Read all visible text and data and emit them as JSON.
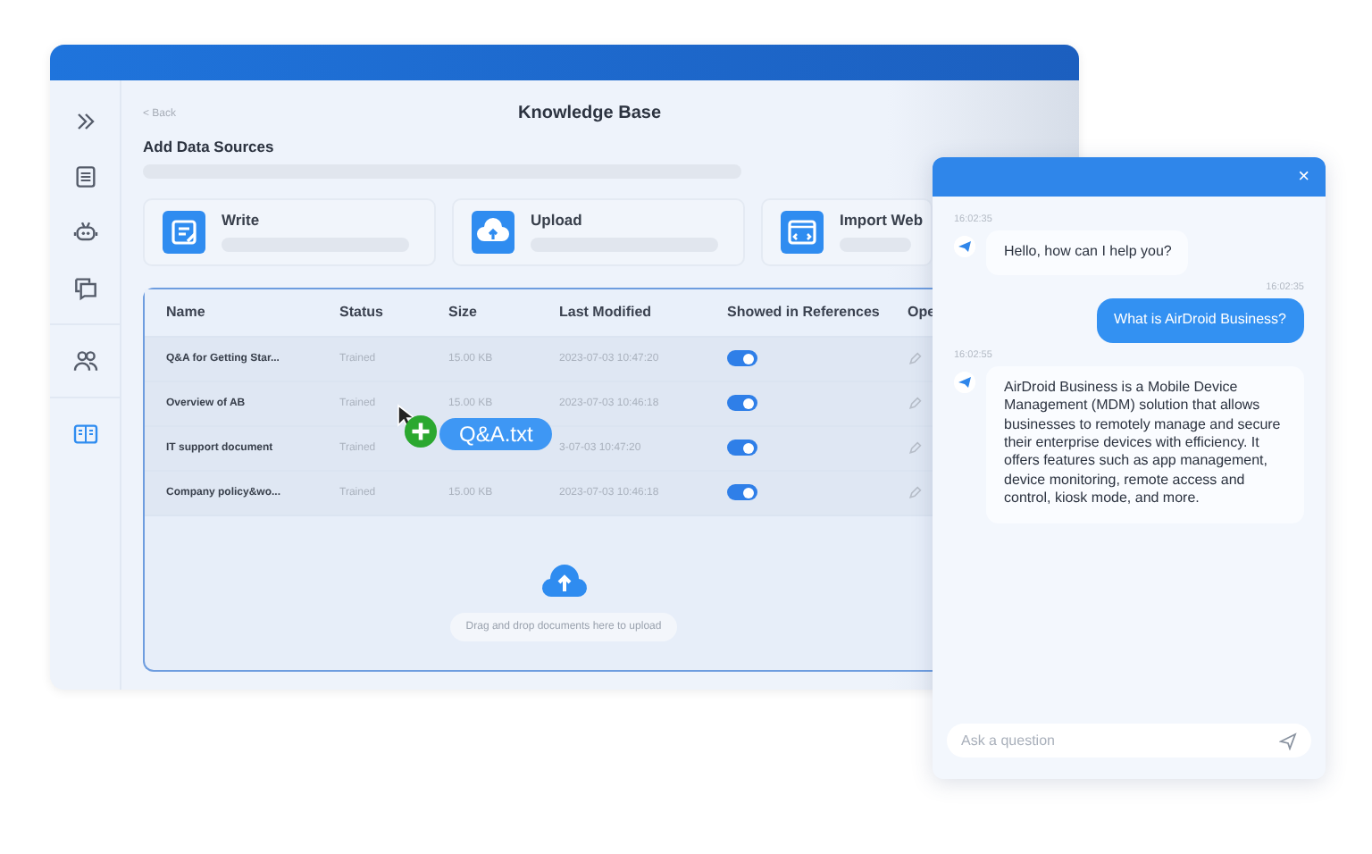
{
  "sidebar": {
    "items": [
      {
        "kind": "expand",
        "selected": false
      },
      {
        "kind": "document",
        "selected": false
      },
      {
        "kind": "robot",
        "selected": false
      },
      {
        "kind": "chat",
        "selected": false
      },
      {
        "kind": "users",
        "selected": false
      },
      {
        "kind": "book",
        "selected": true
      }
    ]
  },
  "header": {
    "back": "< Back",
    "title": "Knowledge Base"
  },
  "section_title": "Add Data Sources",
  "sources": [
    {
      "kind": "write",
      "label": "Write"
    },
    {
      "kind": "upload",
      "label": "Upload"
    },
    {
      "kind": "web",
      "label": "Import Web"
    }
  ],
  "table": {
    "columns": [
      "Name",
      "Status",
      "Size",
      "Last Modified",
      "Showed in References",
      "Ope"
    ],
    "rows": [
      {
        "name": "Q&A for Getting Star...",
        "status": "Trained",
        "size": "15.00 KB",
        "modified": "2023-07-03 10:47:20",
        "on": true
      },
      {
        "name": "Overview of AB",
        "status": "Trained",
        "size": "15.00 KB",
        "modified": "2023-07-03 10:46:18",
        "on": true
      },
      {
        "name": "IT support document",
        "status": "Trained",
        "modified": "3-07-03 10:47:20",
        "on": true
      },
      {
        "name": "Company policy&wo...",
        "status": "Trained",
        "size": "15.00 KB",
        "modified": "2023-07-03 10:46:18",
        "on": true
      }
    ]
  },
  "drop_hint": "Drag and drop documents here to upload",
  "drag_file": "Q&A.txt",
  "chat": {
    "close": "×",
    "messages": [
      {
        "kind": "bot",
        "time": "16:02:35",
        "text": "Hello,  how can I help you?"
      },
      {
        "kind": "user",
        "time": "16:02:35",
        "text": "What is AirDroid Business?"
      },
      {
        "kind": "bot",
        "time": "16:02:55",
        "text": "AirDroid Business is a Mobile Device Management (MDM) solution that allows businesses to remotely manage and secure their enterprise devices with efficiency. It offers features such as app management, device monitoring, remote access and control, kiosk mode, and more."
      }
    ],
    "input": {
      "placeholder": "Ask a question"
    }
  }
}
